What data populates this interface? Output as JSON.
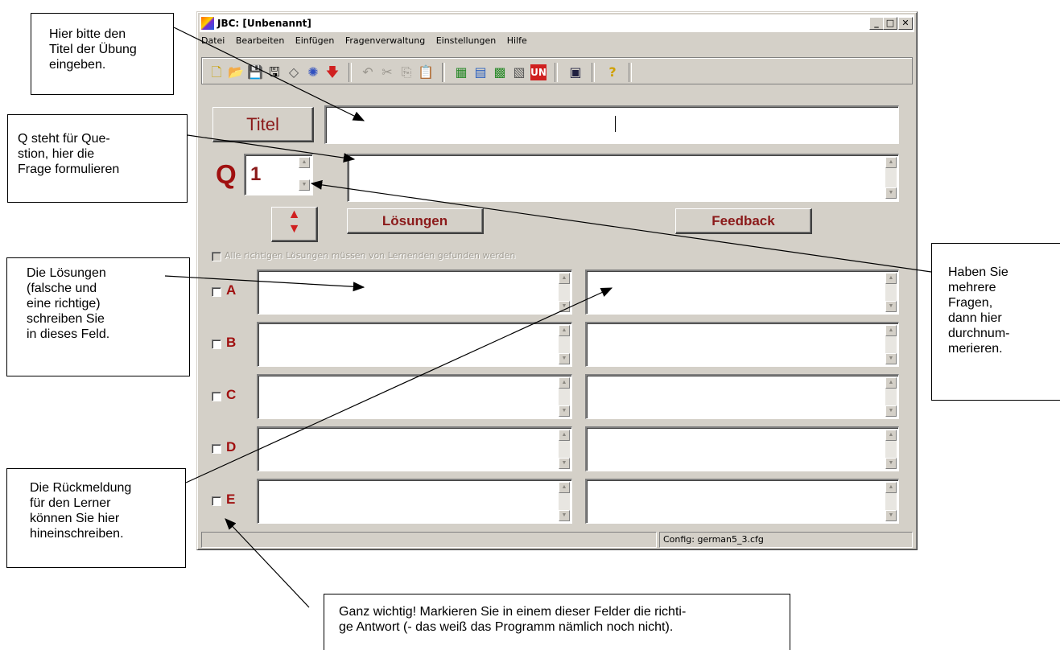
{
  "window": {
    "title": "JBC: [Unbenannt]",
    "controls": [
      "_",
      "□",
      "✕"
    ]
  },
  "menu": [
    "Datei",
    "Bearbeiten",
    "Einfügen",
    "Fragenverwaltung",
    "Einstellungen",
    "Hilfe"
  ],
  "toolbar": {
    "icons": [
      "new-icon",
      "open-icon",
      "save-icon",
      "save-as-icon",
      "erase-icon",
      "web-icon",
      "export-icon",
      "undo-icon",
      "cut-icon",
      "copy-icon",
      "paste-icon",
      "html-export-icon",
      "page-icon",
      "hotpot-icon",
      "quiz-icon",
      "unicode-icon",
      "config-icon",
      "help-icon"
    ]
  },
  "form": {
    "title_button": "Titel",
    "title_value": "",
    "q_label": "Q",
    "q_number": "1",
    "question_value": "",
    "answers_button": "Lösungen",
    "feedback_button": "Feedback",
    "all_correct_label": "Alle richtigen Lösungen müssen von Lernenden gefunden werden",
    "answers": [
      {
        "letter": "A",
        "answer": "",
        "feedback": ""
      },
      {
        "letter": "B",
        "answer": "",
        "feedback": ""
      },
      {
        "letter": "C",
        "answer": "",
        "feedback": ""
      },
      {
        "letter": "D",
        "answer": "",
        "feedback": ""
      },
      {
        "letter": "E",
        "answer": "",
        "feedback": ""
      }
    ]
  },
  "status": {
    "left": "",
    "config": "Config: german5_3.cfg"
  },
  "annotations": {
    "title": "Hier bitte den\nTitel der Übung\neingeben.",
    "question": "Q steht für Que-\nstion, hier die\nFrage formulieren",
    "solutions": "Die Lösungen\n(falsche und\neine richtige)\nschreiben Sie\nin dieses Feld.",
    "feedback": "Die Rückmeldung\nfür den Lerner\nkönnen Sie hier\nhineinschreiben.",
    "numbering": "Haben Sie\nmehrere\nFragen,\ndann hier\ndurchnum-\nmerieren.",
    "mark": "Ganz wichtig! Markieren Sie in einem dieser Felder die richti-\nge Antwort (- das weiß das Programm nämlich noch nicht)."
  },
  "colors": {
    "window_face": "#d4d0c8",
    "label_red": "#a01010",
    "button_text": "#8b1a1a"
  }
}
